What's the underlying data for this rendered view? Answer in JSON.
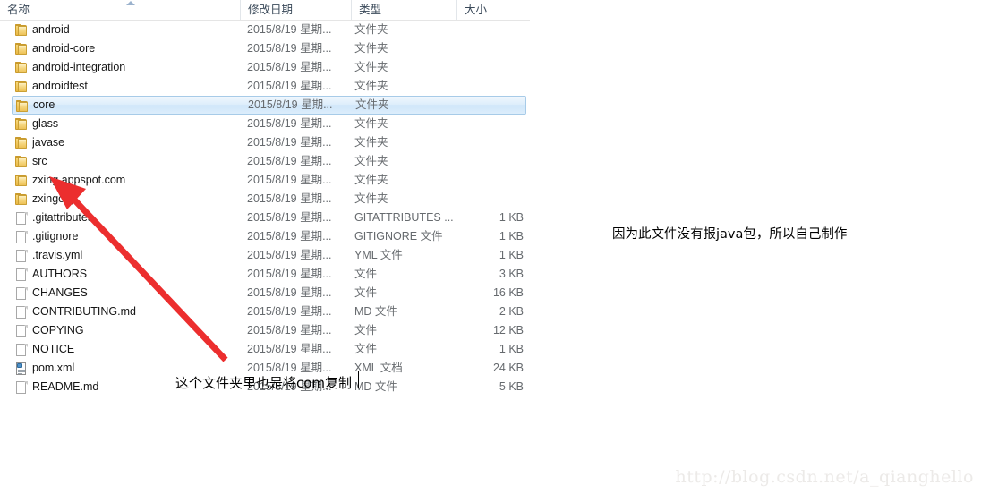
{
  "columns": {
    "name": "名称",
    "date": "修改日期",
    "type": "类型",
    "size": "大小",
    "sort_icon": "sort-ascending-icon"
  },
  "selected_row_index": 4,
  "rows": [
    {
      "icon": "folder-icon",
      "name": "android",
      "date": "2015/8/19 星期...",
      "type": "文件夹",
      "size": ""
    },
    {
      "icon": "folder-icon",
      "name": "android-core",
      "date": "2015/8/19 星期...",
      "type": "文件夹",
      "size": ""
    },
    {
      "icon": "folder-icon",
      "name": "android-integration",
      "date": "2015/8/19 星期...",
      "type": "文件夹",
      "size": ""
    },
    {
      "icon": "folder-icon",
      "name": "androidtest",
      "date": "2015/8/19 星期...",
      "type": "文件夹",
      "size": ""
    },
    {
      "icon": "folder-icon",
      "name": "core",
      "date": "2015/8/19 星期...",
      "type": "文件夹",
      "size": ""
    },
    {
      "icon": "folder-icon",
      "name": "glass",
      "date": "2015/8/19 星期...",
      "type": "文件夹",
      "size": ""
    },
    {
      "icon": "folder-icon",
      "name": "javase",
      "date": "2015/8/19 星期...",
      "type": "文件夹",
      "size": ""
    },
    {
      "icon": "folder-icon",
      "name": "src",
      "date": "2015/8/19 星期...",
      "type": "文件夹",
      "size": ""
    },
    {
      "icon": "folder-icon",
      "name": "zxing.appspot.com",
      "date": "2015/8/19 星期...",
      "type": "文件夹",
      "size": ""
    },
    {
      "icon": "folder-icon",
      "name": "zxingorg",
      "date": "2015/8/19 星期...",
      "type": "文件夹",
      "size": ""
    },
    {
      "icon": "file-icon",
      "name": ".gitattributes",
      "date": "2015/8/19 星期...",
      "type": "GITATTRIBUTES ...",
      "size": "1 KB"
    },
    {
      "icon": "file-icon",
      "name": ".gitignore",
      "date": "2015/8/19 星期...",
      "type": "GITIGNORE 文件",
      "size": "1 KB"
    },
    {
      "icon": "file-icon",
      "name": ".travis.yml",
      "date": "2015/8/19 星期...",
      "type": "YML 文件",
      "size": "1 KB"
    },
    {
      "icon": "file-icon",
      "name": "AUTHORS",
      "date": "2015/8/19 星期...",
      "type": "文件",
      "size": "3 KB"
    },
    {
      "icon": "file-icon",
      "name": "CHANGES",
      "date": "2015/8/19 星期...",
      "type": "文件",
      "size": "16 KB"
    },
    {
      "icon": "file-icon",
      "name": "CONTRIBUTING.md",
      "date": "2015/8/19 星期...",
      "type": "MD 文件",
      "size": "2 KB"
    },
    {
      "icon": "file-icon",
      "name": "COPYING",
      "date": "2015/8/19 星期...",
      "type": "文件",
      "size": "12 KB"
    },
    {
      "icon": "file-icon",
      "name": "NOTICE",
      "date": "2015/8/19 星期...",
      "type": "文件",
      "size": "1 KB"
    },
    {
      "icon": "xml-icon",
      "name": "pom.xml",
      "date": "2015/8/19 星期...",
      "type": "XML 文档",
      "size": "24 KB"
    },
    {
      "icon": "file-icon",
      "name": "README.md",
      "date": "2015/8/19 星期...",
      "type": "MD 文件",
      "size": "5 KB"
    }
  ],
  "annotations": {
    "right_note": "因为此文件没有报java包，所以自己制作",
    "bottom_note": "这个文件夹里也是将com复制",
    "arrow_color": "#ec2e2e",
    "arrow_points_at": "src"
  },
  "watermark": "http://blog.csdn.net/a_qianghello"
}
